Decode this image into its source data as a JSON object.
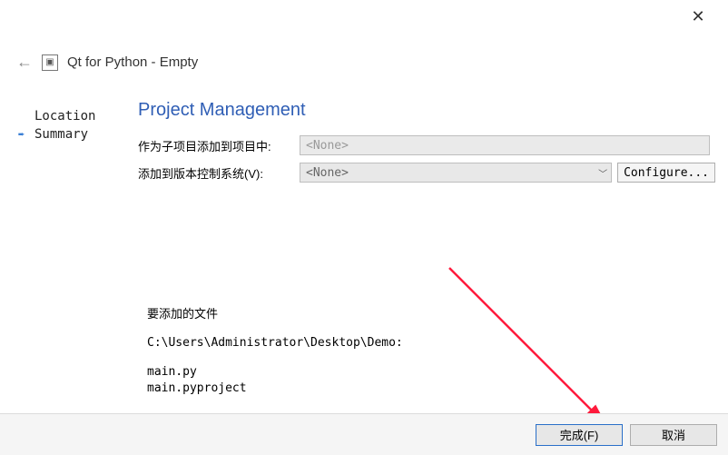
{
  "window": {
    "title": "Qt for Python - Empty"
  },
  "sidebar": {
    "items": [
      {
        "label": "Location",
        "active": false
      },
      {
        "label": "Summary",
        "active": true
      }
    ]
  },
  "page": {
    "title": "Project Management",
    "subproject_label": "作为子项目添加到项目中:",
    "subproject_value": "<None>",
    "vcs_label": "添加到版本控制系统(V):",
    "vcs_value": "<None>",
    "configure_label": "Configure..."
  },
  "files": {
    "heading": "要添加的文件",
    "path": "C:\\Users\\Administrator\\Desktop\\Demo:",
    "list": [
      "main.py",
      "main.pyproject"
    ]
  },
  "footer": {
    "finish": "完成(F)",
    "cancel": "取消"
  }
}
